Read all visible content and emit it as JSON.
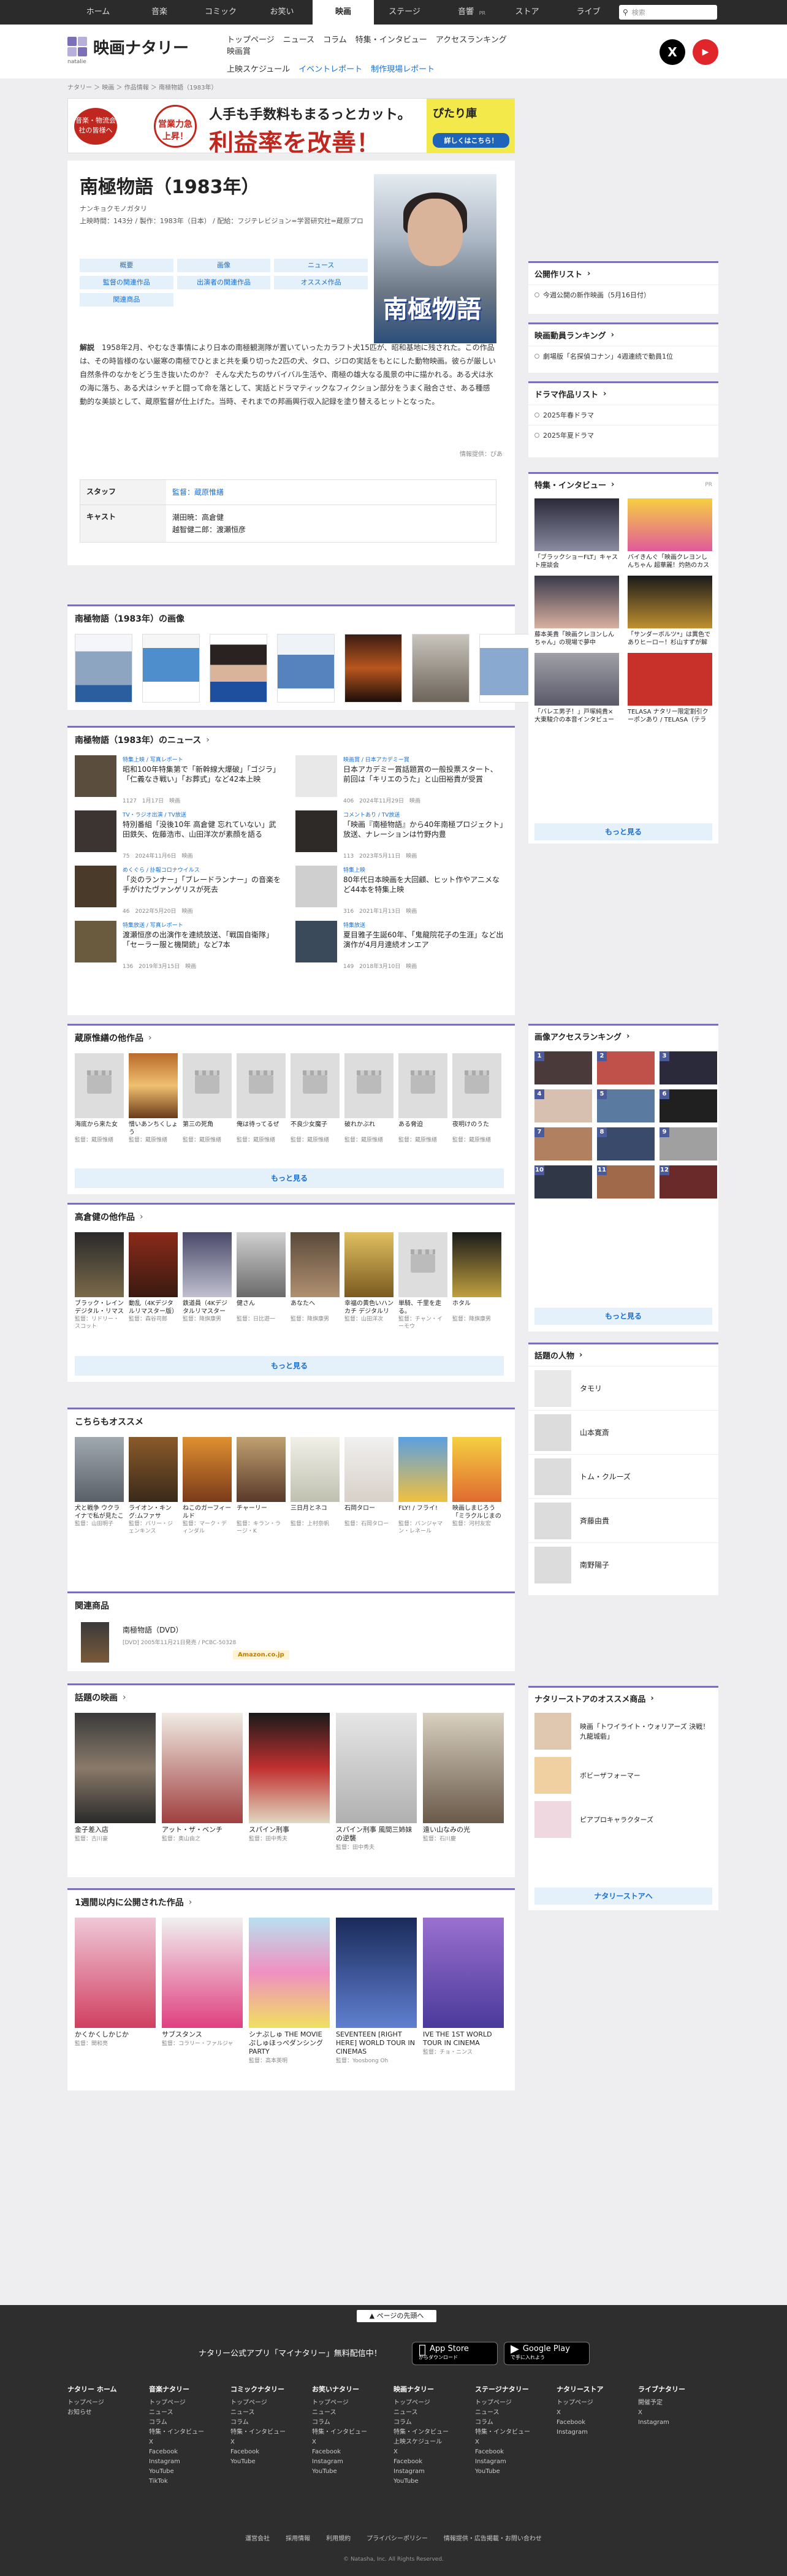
{
  "nav": {
    "tabs": [
      "ホーム",
      "音楽",
      "コミック",
      "お笑い",
      "映画",
      "ステージ",
      "音響",
      "ストア",
      "ライブ"
    ],
    "active": 4,
    "pr_label": "PR",
    "search_placeholder": "検索"
  },
  "header": {
    "logo": "映画ナタリー",
    "logo_sub": "natalie",
    "subnav_row1": [
      "トップページ",
      "ニュース",
      "コラム",
      "特集・インタビュー",
      "アクセスランキング",
      "映画賞"
    ],
    "subnav_row2": [
      "上映スケジュール",
      "イベントレポート",
      "制作現場レポート"
    ],
    "social": [
      "X",
      "YouTube"
    ]
  },
  "breadcrumb": "ナタリー ＞ 映画 ＞ 作品情報 ＞ 南極物語（1983年）",
  "banner": {
    "circle1": "音楽・物流会社の皆様へ",
    "circle2": "営業力急上昇！",
    "line1": "人手も手数料もまるっとカット。",
    "line2": "利益率を改善！",
    "cta_title": "ぴたり庫",
    "cta_button": "詳しくはこちら！"
  },
  "movie": {
    "title": "南極物語（1983年）",
    "kana": "ナンキョクモノガタリ",
    "meta": "上映時間：143分 / 製作：1983年（日本） / 配給：フジテレビジョン=学習研究社=蔵原プロ",
    "poster_title": "南極物語",
    "links": [
      "概要",
      "画像",
      "ニュース",
      "監督の関連作品",
      "出演者の関連作品",
      "オススメ作品",
      "関連商品"
    ],
    "desc_label": "解説",
    "desc": "1958年2月、やむなき事情により日本の南極観測隊が置いていったカラフト犬15匹が、昭和基地に残された。この作品は、その時皆様のない厳寒の南極でひとまと共を乗り切った2匹の犬、タロ、ジロの実話をもとにした動物映画。彼らが厳しい自然条件のなかをどう生き抜いたのか？ そんな犬たちのサバイバル生活や、南極の雄大なる風景の中に描かれる。ある犬は氷の海に落ち、ある犬はシャチと闘って命を落として、実話とドラマティックなフィクション部分をうまく融合させ、ある種感動的な美談として、蔵原監督が仕上げた。当時、それまでの邦画興行収入記録を塗り替えるヒットとなった。",
    "credit": "情報提供：ぴあ",
    "staff_label": "スタッフ",
    "staff": "監督：蔵原惟繕",
    "cast_label": "キャスト",
    "cast1": "潮田暁：高倉健",
    "cast2": "越智健二郎：渡瀬恒彦"
  },
  "images": {
    "title": "南極物語（1983年）の画像"
  },
  "news": {
    "title": "南極物語（1983年）のニュース",
    "items": [
      {
        "tag": "特集上映 / 写真レポート",
        "h": "昭和100年特集第で「新幹線大爆破」「ゴジラ」「仁義なき戦い」「お葬式」など42本上映",
        "f": "1127　1月17日　映画"
      },
      {
        "tag": "映画賞 / 日本アカデミー賞",
        "h": "日本アカデミー賞話題賞の一般投票スタート、前回は「キリエのうた」と山田裕貴が受賞",
        "f": "406　2024年11月29日　映画"
      },
      {
        "tag": "TV・ラジオ出演 / TV放送",
        "h": "特別番組「没後10年 高倉健 忘れていない」武田鉄矢、佐藤浩市、山田洋次が素顔を語る",
        "f": "75　2024年11月6日　映画"
      },
      {
        "tag": "コメントあり / TV放送",
        "h": "「映画『南極物語』から40年南極プロジェクト」放送、ナレーションは竹野内豊",
        "f": "113　2023年5月11日　映画"
      },
      {
        "tag": "めくぐら / 訃報コロナウイルス",
        "h": "「炎のランナー」「ブレードランナー」の音楽を手がけたヴァンゲリスが死去",
        "f": "46　2022年5月20日　映画"
      },
      {
        "tag": "特集上映",
        "h": "80年代日本映画を大回顧、ヒット作やアニメなど44本を特集上映",
        "f": "316　2021年1月13日　映画"
      },
      {
        "tag": "特集放送 / 写真レポート",
        "h": "渡瀬恒彦の出演作を連続放送、「戦国自衛隊」「セーラー服と機関銃」など7本",
        "f": "136　2019年3月15日　映画"
      },
      {
        "tag": "特集放送",
        "h": "夏目雅子生誕60年、「鬼龍院花子の生涯」など出演作が4月月連続オンエア",
        "f": "149　2018年3月10日　映画"
      }
    ]
  },
  "director_works": {
    "title": "蔵原惟繕の他作品",
    "more": "もっと見る",
    "items": [
      {
        "n": "海底から来た女",
        "d": "監督：蔵原惟繕"
      },
      {
        "n": "憎いあンちくしょう",
        "d": "監督：蔵原惟繕"
      },
      {
        "n": "第三の死角",
        "d": "監督：蔵原惟繕"
      },
      {
        "n": "俺は待ってるぜ",
        "d": "監督：蔵原惟繕"
      },
      {
        "n": "不良少女魔子",
        "d": "監督：蔵原惟繕"
      },
      {
        "n": "破れかぶれ",
        "d": "監督：蔵原惟繕"
      },
      {
        "n": "ある脅迫",
        "d": "監督：蔵原惟繕"
      },
      {
        "n": "夜明けのうた",
        "d": "監督：蔵原惟繕"
      }
    ]
  },
  "actor_works": {
    "title": "高倉健の他作品",
    "more": "もっと見る",
    "items": [
      {
        "n": "ブラック・レイン デジタル・リマスター版",
        "d": "監督：リドリー・スコット"
      },
      {
        "n": "動乱（4Kデジタルリマスター版）",
        "d": "監督：森谷司郎"
      },
      {
        "n": "鉄道員（4Kデジタルリマスター版）",
        "d": "監督：降旗康男"
      },
      {
        "n": "健さん",
        "d": "監督：日比遊一"
      },
      {
        "n": "あなたへ",
        "d": "監督：降旗康男"
      },
      {
        "n": "幸福の黄色いハンカチ デジタルリマスター版",
        "d": "監督：山田洋次"
      },
      {
        "n": "単騎、千里を走る。",
        "d": "監督：チャン・イーモウ"
      },
      {
        "n": "ホタル",
        "d": "監督：降旗康男"
      }
    ]
  },
  "recommend": {
    "title": "こちらもオススメ",
    "items": [
      {
        "n": "犬と戦争 ウクライナで私が見たこと",
        "d": "監督：山田明子"
      },
      {
        "n": "ライオン・キング:ムファサ",
        "d": "監督：バリー・ジェンキンス"
      },
      {
        "n": "ねこのガーフィールド",
        "d": "監督：マーク・ディンダル"
      },
      {
        "n": "チャーリー",
        "d": "監督：キラン・ラージ・K"
      },
      {
        "n": "三日月とネコ",
        "d": "監督：上村奈帆"
      },
      {
        "n": "石岡タロー",
        "d": "監督：石岡タロー"
      },
      {
        "n": "FLY! / フライ!",
        "d": "監督：バンジャマン・レネール"
      },
      {
        "n": "映画しまじろう「ミラクルじまの なないろカーネーション」",
        "d": "監督：河村友宏"
      }
    ]
  },
  "goods": {
    "title": "関連商品",
    "name": "南極物語（DVD）",
    "info": "[DVD] 2005年11月21日発売 / PCBC-50328",
    "shop": "Amazon.co.jp"
  },
  "topic_films": {
    "title": "話題の映画",
    "items": [
      {
        "n": "金子差入店",
        "d": "監督：古川豪"
      },
      {
        "n": "アット・ザ・ベンチ",
        "d": "監督：奥山由之"
      },
      {
        "n": "スパイン刑事",
        "d": "監督：田中秀夫"
      },
      {
        "n": "スパイン刑事 風間三姉妹の逆襲",
        "d": "監督：田中秀夫"
      },
      {
        "n": "遠い山なみの光",
        "d": "監督：石川慶"
      }
    ]
  },
  "week_films": {
    "title": "1週間以内に公開された作品",
    "items": [
      {
        "n": "かくかくしかじか",
        "d": "監督：関和亮"
      },
      {
        "n": "サブスタンス",
        "d": "監督：コラリー・ファルジャ"
      },
      {
        "n": "シナぷしゅ THE MOVIE ぷしゅほっぺダンシングPARTY",
        "d": "監督：高本英明"
      },
      {
        "n": "SEVENTEEN [RIGHT HERE] WORLD TOUR IN CINEMAS",
        "d": "監督：Yoosbong Oh"
      },
      {
        "n": "IVE THE 1ST WORLD TOUR IN CINEMA",
        "d": "監督：チョ・ニンス"
      }
    ]
  },
  "sidebar": {
    "public": {
      "title": "公開作リスト",
      "item": "今週公開の新作映画（5月16日付）"
    },
    "boxoffice": {
      "title": "映画動員ランキング",
      "item": "劇場版「名探偵コナン」4週連続で動員1位"
    },
    "drama": {
      "title": "ドラマ作品リスト",
      "items": [
        "2025年春ドラマ",
        "2025年夏ドラマ"
      ]
    },
    "features": {
      "title": "特集・インタビュー",
      "pr": "PR",
      "more": "もっと見る",
      "items": [
        {
          "n": "「ブラックショーFLT」キャスト座談会"
        },
        {
          "n": "バイきんぐ「映画クレヨンしんちゃん 超華麗！灼熱のカスカベダンサーズ」出演裏話"
        },
        {
          "n": "藤本美貴「映画クレヨンしんちゃん」の現場で夢中"
        },
        {
          "n": "「サンダーボルツ*」は異色でありヒーロー！杉山すずが解説"
        },
        {
          "n": "「バレエ男子！」戸塚純貴×大東駿介の本音インタビュー"
        },
        {
          "n": "TELASA ナタリー限定割引クーポンあり / TELASA（テラサ）ニュース・特集まとめ"
        }
      ]
    },
    "access": {
      "title": "画像アクセスランキング",
      "more": "もっと見る",
      "nums": [
        "1",
        "2",
        "3",
        "4",
        "5",
        "6",
        "7",
        "8",
        "9",
        "10",
        "11",
        "12"
      ]
    },
    "people": {
      "title": "話題の人物",
      "items": [
        "タモリ",
        "山本寛斎",
        "トム・クルーズ",
        "斉藤由貴",
        "南野陽子"
      ]
    },
    "store": {
      "title": "ナタリーストアのオススメ商品",
      "items": [
        "映画「トワイライト・ウォリアーズ 決戦！九龍城砦」",
        "ボビーザフォーマー",
        "ピアプロキャラクターズ"
      ],
      "button": "ナタリーストアへ"
    }
  },
  "footer": {
    "totop": "ページの先頭へ",
    "app_text": "ナタリー公式アプリ「マイナタリー」無料配信中！",
    "appstore": "App Store",
    "appstore_small": "からダウンロード",
    "googleplay": "Google Play",
    "googleplay_small": "で手に入れよう",
    "cols": [
      {
        "h": "ナタリー ホーム",
        "l": [
          "トップページ",
          "お知らせ"
        ]
      },
      {
        "h": "音楽ナタリー",
        "l": [
          "トップページ",
          "ニュース",
          "コラム",
          "特集・インタビュー",
          "X",
          "Facebook",
          "Instagram",
          "YouTube",
          "TikTok"
        ]
      },
      {
        "h": "コミックナタリー",
        "l": [
          "トップページ",
          "ニュース",
          "コラム",
          "特集・インタビュー",
          "X",
          "Facebook",
          "YouTube"
        ]
      },
      {
        "h": "お笑いナタリー",
        "l": [
          "トップページ",
          "ニュース",
          "コラム",
          "特集・インタビュー",
          "X",
          "Facebook",
          "Instagram",
          "YouTube"
        ]
      },
      {
        "h": "映画ナタリー",
        "l": [
          "トップページ",
          "ニュース",
          "コラム",
          "特集・インタビュー",
          "上映スケジュール",
          "X",
          "Facebook",
          "Instagram",
          "YouTube"
        ]
      },
      {
        "h": "ステージナタリー",
        "l": [
          "トップページ",
          "ニュース",
          "コラム",
          "特集・インタビュー",
          "X",
          "Facebook",
          "Instagram",
          "YouTube"
        ]
      },
      {
        "h": "ナタリーストア",
        "l": [
          "トップページ",
          "X",
          "Facebook",
          "Instagram"
        ]
      },
      {
        "h": "ライブナタリー",
        "l": [
          "開催予定",
          "X",
          "Instagram"
        ]
      }
    ],
    "links": [
      "運営会社",
      "採用情報",
      "利用規約",
      "プライバシーポリシー",
      "情報提供・広告掲載・お問い合わせ"
    ],
    "copy": "© Natasha, Inc. All Rights Reserved."
  }
}
